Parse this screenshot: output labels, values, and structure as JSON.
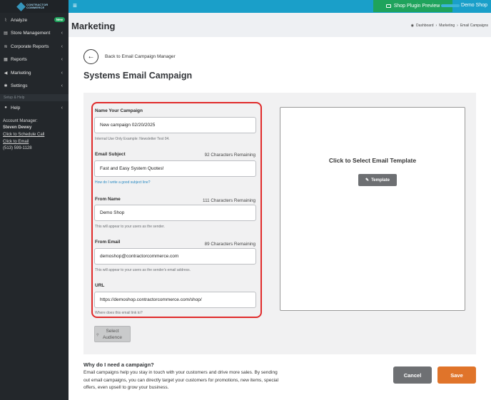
{
  "topbar": {
    "menu_icon": "hamburger-icon",
    "preview_label": "Shop Plugin Preview",
    "shop_name": "Demo Shop"
  },
  "sidebar": {
    "logo_text": "CONTRACTOR COMMERCE",
    "items": [
      {
        "label": "Analyze",
        "icon": "chart-line-icon",
        "badge": "New"
      },
      {
        "label": "Store Management",
        "icon": "store-icon"
      },
      {
        "label": "Corporate Reports",
        "icon": "layers-icon"
      },
      {
        "label": "Reports",
        "icon": "table-icon"
      },
      {
        "label": "Marketing",
        "icon": "megaphone-icon"
      },
      {
        "label": "Settings",
        "icon": "gear-icon"
      }
    ],
    "section_label": "Setup & Help",
    "help_label": "Help",
    "account": {
      "label": "Account Manager:",
      "name": "Steven Dewey",
      "schedule_link": "Click to Schedule Call",
      "email_link": "Click to Email",
      "phone": "(513) 599-1128"
    }
  },
  "header": {
    "title": "Marketing",
    "breadcrumb": [
      "Dashboard",
      "Marketing",
      "Email Campaigns"
    ]
  },
  "main": {
    "back_label": "Back to Email Campaign Manager",
    "heading": "Systems Email Campaign",
    "form": {
      "campaign_name": {
        "label": "Name Your Campaign",
        "value": "New campaign 02/20/2025",
        "help": "Internal Use Only Example: Newsletter Test 04."
      },
      "subject": {
        "label": "Email Subject",
        "remaining": "92 Characters Remaining",
        "value": "Fast and Easy System Quotes!",
        "help": "How do I write a good subject line?"
      },
      "from_name": {
        "label": "From Name",
        "remaining": "111 Characters Remaining",
        "value": "Demo Shop",
        "help": "This will appear to your users as the sender."
      },
      "from_email": {
        "label": "From Email",
        "remaining": "89 Characters Remaining",
        "value": "demoshop@contractorcommerce.com",
        "help": "This will appear to your users as the sender's email address."
      },
      "url": {
        "label": "URL",
        "value": "https://demoshop.contractorcommerce.com/shop/",
        "help": "Where does this email link to?"
      }
    },
    "select_audience": [
      "Select",
      "Audience"
    ],
    "template": {
      "title": "Click to Select Email Template",
      "button": "Template"
    },
    "why": {
      "title": "Why do I need a campaign?",
      "text": "Email campaigns help you stay in touch with your customers and drive more sales. By sending out email campaigns, you can directly target your customers for promotions, new items, special offers, even upsell to grow your business."
    },
    "cancel_label": "Cancel",
    "save_label": "Save"
  },
  "colors": {
    "topbar": "#1a9fc9",
    "sidebar": "#23272b",
    "preview_button": "#1fa35c",
    "highlight_border": "#e02a2a",
    "save_button": "#e0742a",
    "cancel_button": "#6e7073",
    "link": "#2a8ac2"
  }
}
